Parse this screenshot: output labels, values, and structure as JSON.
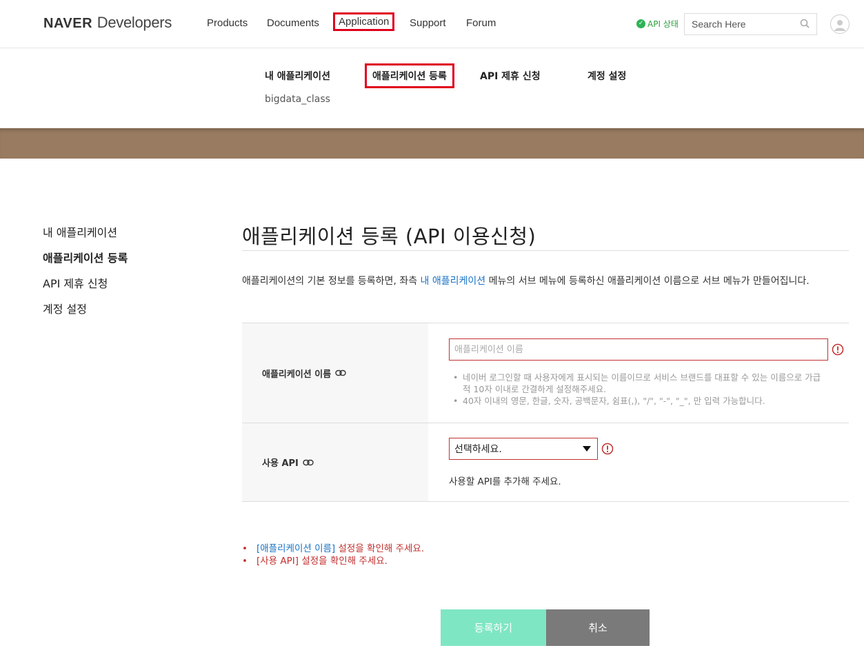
{
  "header": {
    "logo_bold": "NAVER",
    "logo_light": "Developers",
    "nav": [
      {
        "label": "Products"
      },
      {
        "label": "Documents"
      },
      {
        "label": "Application"
      },
      {
        "label": "Support"
      },
      {
        "label": "Forum"
      }
    ],
    "api_status": "API 상태",
    "search_placeholder": "Search Here"
  },
  "subnav": {
    "items": [
      {
        "label": "내 애플리케이션"
      },
      {
        "label": "애플리케이션 등록"
      },
      {
        "label": "API 제휴 신청"
      },
      {
        "label": "계정 설정"
      }
    ],
    "app_name": "bigdata_class"
  },
  "sidebar": {
    "items": [
      {
        "label": "내 애플리케이션"
      },
      {
        "label": "애플리케이션 등록"
      },
      {
        "label": "API 제휴 신청"
      },
      {
        "label": "계정 설정"
      }
    ]
  },
  "main": {
    "title": "애플리케이션 등록 (API 이용신청)",
    "intro_before": "애플리케이션의 기본 정보를 등록하면, 좌측 ",
    "intro_link": "내 애플리케이션",
    "intro_after": " 메뉴의 서브 메뉴에 등록하신 애플리케이션 이름으로 서브 메뉴가 만들어집니다.",
    "app_name_label": "애플리케이션 이름",
    "app_name_placeholder": "애플리케이션 이름",
    "app_name_hints": [
      "네이버 로그인할 때 사용자에게 표시되는 이름이므로 서비스 브랜드를 대표할 수 있는 이름으로 가급적 10자 이내로 간결하게 설정해주세요.",
      "40자 이내의 영문, 한글, 숫자, 공백문자, 쉼표(,), \"/\", \"-\", \"_\", 만 입력 가능합니다."
    ],
    "api_label": "사용 API",
    "api_select_value": "선택하세요.",
    "api_help": "사용할 API를 추가해 주세요.",
    "errors": [
      {
        "field": "[애플리케이션 이름]",
        "message": " 설정을 확인해 주세요."
      },
      {
        "field": "[사용 API]",
        "message": " 설정을 확인해 주세요."
      }
    ],
    "submit_label": "등록하기",
    "cancel_label": "취소"
  },
  "colors": {
    "accent_red": "#e0001b",
    "banner": "#987b60",
    "link_blue": "#1a73c5",
    "error_red": "#c23030",
    "submit_bg": "#7fe6c3",
    "cancel_bg": "#7a7a7a"
  },
  "icons": [
    "check-circle-icon",
    "search-icon",
    "user-icon",
    "link-icon",
    "error-icon",
    "caret-down-icon"
  ]
}
